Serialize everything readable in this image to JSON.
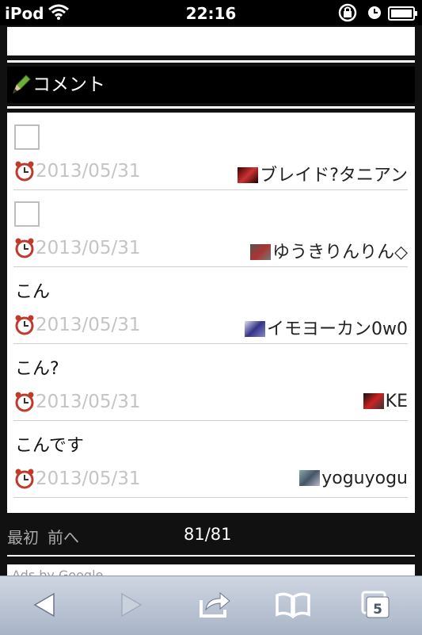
{
  "status_bar": {
    "carrier": "iPod",
    "time": "22:16"
  },
  "section": {
    "title": "コメント"
  },
  "comments": [
    {
      "text": "",
      "has_checkbox": true,
      "date": "2013/05/31",
      "author": "ブレイド?タニアン"
    },
    {
      "text": "",
      "has_checkbox": true,
      "date": "2013/05/31",
      "author": "ゆうきりんりん◇"
    },
    {
      "text": "こん",
      "has_checkbox": false,
      "date": "2013/05/31",
      "author": "イモヨーカン0w0"
    },
    {
      "text": "こん?",
      "has_checkbox": false,
      "date": "2013/05/31",
      "author": "KE"
    },
    {
      "text": "こんです",
      "has_checkbox": false,
      "date": "2013/05/31",
      "author": "yoguyogu"
    }
  ],
  "pager": {
    "first": "最初",
    "prev": "前へ",
    "count": "81/81"
  },
  "ads": {
    "label": "Ads by Google"
  },
  "toolbar": {
    "tab_count": "5"
  },
  "colors": {
    "header_bg": "#000000",
    "page_bg": "#111111",
    "date_text": "#c4c4c4",
    "toolbar_top": "#cfd6e2",
    "toolbar_bottom": "#a8b4c6"
  },
  "icons": [
    "wifi-icon",
    "orientation-lock-icon",
    "alarm-status-icon",
    "battery-icon",
    "pencil-icon",
    "alarm-clock-icon",
    "back-icon",
    "forward-icon",
    "share-icon",
    "bookmarks-icon",
    "tabs-icon"
  ]
}
